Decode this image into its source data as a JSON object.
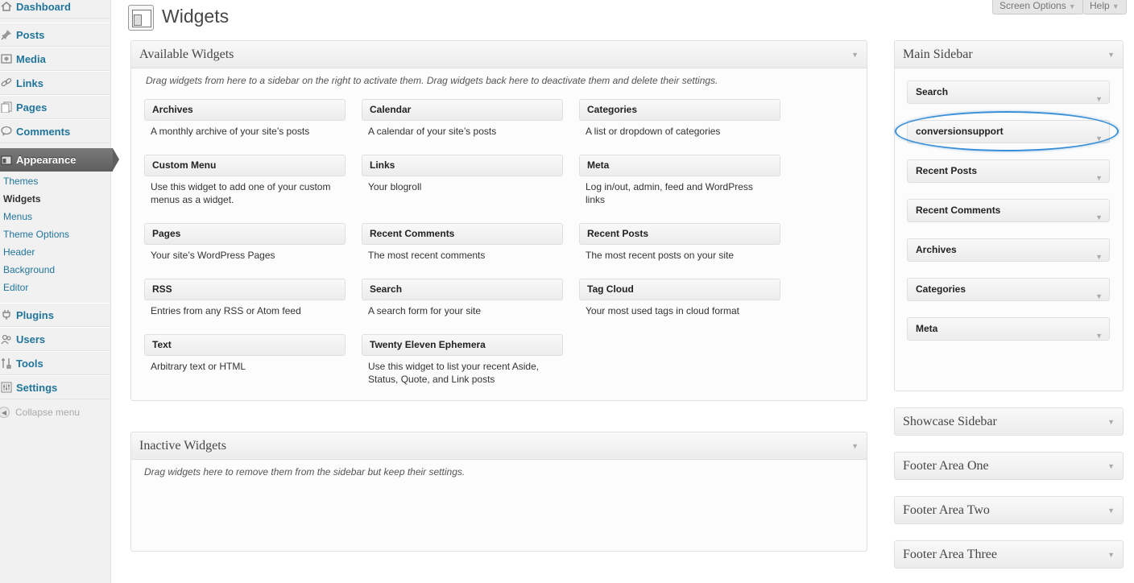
{
  "menu": {
    "dashboard": "Dashboard",
    "posts": "Posts",
    "media": "Media",
    "links": "Links",
    "pages": "Pages",
    "comments": "Comments",
    "appearance": "Appearance",
    "plugins": "Plugins",
    "users": "Users",
    "tools": "Tools",
    "settings": "Settings",
    "collapse": "Collapse menu",
    "submenu": [
      "Themes",
      "Widgets",
      "Menus",
      "Theme Options",
      "Header",
      "Background",
      "Editor"
    ]
  },
  "header": {
    "title": "Widgets",
    "screen_options": "Screen Options",
    "help": "Help"
  },
  "available": {
    "title": "Available Widgets",
    "description": "Drag widgets from here to a sidebar on the right to activate them. Drag widgets back here to deactivate them and delete their settings.",
    "widgets": [
      {
        "title": "Archives",
        "desc": "A monthly archive of your site’s posts"
      },
      {
        "title": "Calendar",
        "desc": "A calendar of your site’s posts"
      },
      {
        "title": "Categories",
        "desc": "A list or dropdown of categories"
      },
      {
        "title": "Custom Menu",
        "desc": "Use this widget to add one of your custom menus as a widget."
      },
      {
        "title": "Links",
        "desc": "Your blogroll"
      },
      {
        "title": "Meta",
        "desc": "Log in/out, admin, feed and WordPress links"
      },
      {
        "title": "Pages",
        "desc": "Your site’s WordPress Pages"
      },
      {
        "title": "Recent Comments",
        "desc": "The most recent comments"
      },
      {
        "title": "Recent Posts",
        "desc": "The most recent posts on your site"
      },
      {
        "title": "RSS",
        "desc": "Entries from any RSS or Atom feed"
      },
      {
        "title": "Search",
        "desc": "A search form for your site"
      },
      {
        "title": "Tag Cloud",
        "desc": "Your most used tags in cloud format"
      },
      {
        "title": "Text",
        "desc": "Arbitrary text or HTML"
      },
      {
        "title": "Twenty Eleven Ephemera",
        "desc": "Use this widget to list your recent Aside, Status, Quote, and Link posts"
      }
    ]
  },
  "inactive": {
    "title": "Inactive Widgets",
    "description": "Drag widgets here to remove them from the sidebar but keep their settings."
  },
  "main_sidebar": {
    "title": "Main Sidebar",
    "widgets": [
      "Search",
      "conversionsupport",
      "Recent Posts",
      "Recent Comments",
      "Archives",
      "Categories",
      "Meta"
    ]
  },
  "other_sidebars": [
    "Showcase Sidebar",
    "Footer Area One",
    "Footer Area Two",
    "Footer Area Three"
  ],
  "colors": {
    "link": "#21759b",
    "highlight": "#3b8fd6",
    "menu_current": "#6d6d6d"
  }
}
